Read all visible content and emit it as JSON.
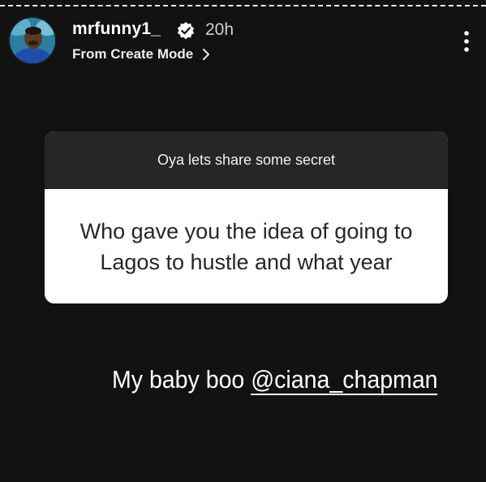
{
  "story": {
    "username": "mrfunny1_",
    "time": "20h",
    "subtitle": "From Create Mode"
  },
  "question_card": {
    "prompt": "Oya lets share some secret",
    "question": "Who gave you the idea of going to Lagos to hustle and what year"
  },
  "reply": {
    "text": "My baby boo ",
    "mention": "@ciana_chapman"
  },
  "icons": {
    "verified": "verified-badge-icon",
    "chevron": "chevron-right-icon",
    "more": "more-vertical-icon"
  },
  "colors": {
    "background": "#121212",
    "card_header": "#262626",
    "card_body": "#ffffff",
    "text": "#ffffff"
  }
}
